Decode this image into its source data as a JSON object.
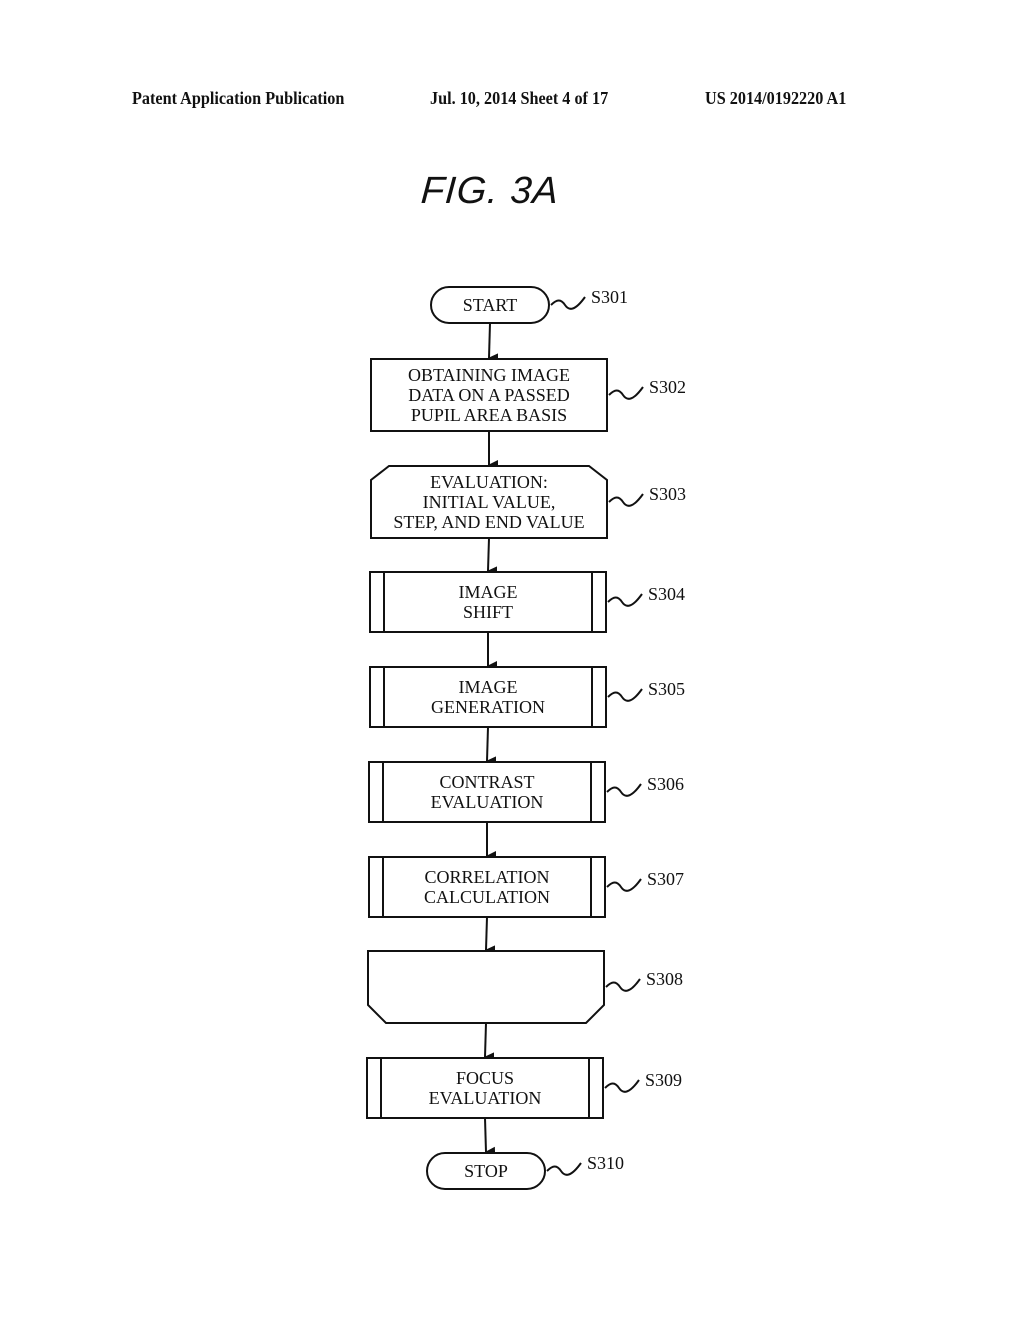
{
  "header": {
    "publication": "Patent Application Publication",
    "date_sheet": "Jul. 10, 2014   Sheet 4 of 17",
    "number": "US 2014/0192220 A1"
  },
  "figure": {
    "title": "FIG. 3A"
  },
  "flowchart": {
    "steps": [
      {
        "id": "S301",
        "type": "terminal",
        "lines": [
          "START"
        ]
      },
      {
        "id": "S302",
        "type": "process",
        "lines": [
          "OBTAINING IMAGE",
          "DATA ON A PASSED",
          "PUPIL AREA BASIS"
        ]
      },
      {
        "id": "S303",
        "type": "loop-start",
        "lines": [
          "EVALUATION:",
          "INITIAL VALUE,",
          "STEP, AND END VALUE"
        ]
      },
      {
        "id": "S304",
        "type": "subroutine",
        "lines": [
          "IMAGE",
          "SHIFT"
        ]
      },
      {
        "id": "S305",
        "type": "subroutine",
        "lines": [
          "IMAGE",
          "GENERATION"
        ]
      },
      {
        "id": "S306",
        "type": "subroutine",
        "lines": [
          "CONTRAST",
          "EVALUATION"
        ]
      },
      {
        "id": "S307",
        "type": "subroutine",
        "lines": [
          "CORRELATION",
          "CALCULATION"
        ]
      },
      {
        "id": "S308",
        "type": "loop-end",
        "lines": []
      },
      {
        "id": "S309",
        "type": "subroutine",
        "lines": [
          "FOCUS",
          "EVALUATION"
        ]
      },
      {
        "id": "S310",
        "type": "terminal",
        "lines": [
          "STOP"
        ]
      }
    ]
  }
}
